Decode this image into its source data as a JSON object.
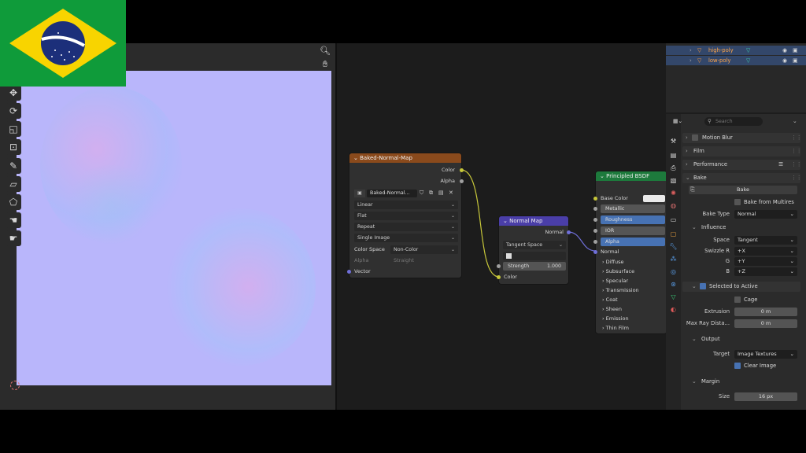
{
  "flag": {
    "name": "brazil-flag",
    "colors": {
      "green": "#0f9b3a",
      "yellow": "#f8d400",
      "blue": "#1c2f7a"
    }
  },
  "node_editor": {
    "image_node": {
      "title": "Baked-Normal-Map",
      "outputs": [
        "Color",
        "Alpha"
      ],
      "image_name": "Baked-Normal...",
      "interpolation": "Linear",
      "projection": "Flat",
      "extension": "Repeat",
      "source": "Single Image",
      "color_space_label": "Color Space",
      "color_space": "Non-Color",
      "alpha_label": "Alpha",
      "alpha_value": "Straight",
      "vector_input": "Vector",
      "header_color": "#8a4a1c"
    },
    "normal_map_node": {
      "title": "Normal Map",
      "output": "Normal",
      "space": "Tangent Space",
      "strength_label": "Strength",
      "strength_value": "1.000",
      "color_input": "Color",
      "header_color": "#4a3ea8"
    },
    "bsdf_node": {
      "title": "Principled BSDF",
      "header_color": "#1d7a3c",
      "base_color": "Base Color",
      "metallic": "Metallic",
      "roughness": "Roughness",
      "ior": "IOR",
      "alpha": "Alpha",
      "normal": "Normal",
      "panels": [
        "Diffuse",
        "Subsurface",
        "Specular",
        "Transmission",
        "Coat",
        "Sheen",
        "Emission",
        "Thin Film"
      ]
    }
  },
  "outliner": {
    "items": [
      {
        "label": "high-poly"
      },
      {
        "label": "low-poly"
      }
    ]
  },
  "properties": {
    "search_placeholder": "Search",
    "motion_blur": "Motion Blur",
    "film": "Film",
    "performance": "Performance",
    "bake": "Bake",
    "bake_button": "Bake",
    "bake_from_multires": "Bake from Multires",
    "bake_type_label": "Bake Type",
    "bake_type": "Normal",
    "influence": "Influence",
    "space_label": "Space",
    "space": "Tangent",
    "swizzle_r_label": "Swizzle R",
    "swizzle_r": "+X",
    "swizzle_g_label": "G",
    "swizzle_g": "+Y",
    "swizzle_b_label": "B",
    "swizzle_b": "+Z",
    "selected_to_active": "Selected to Active",
    "cage": "Cage",
    "extrusion_label": "Extrusion",
    "extrusion": "0 m",
    "max_ray_label": "Max Ray Dista...",
    "max_ray": "0 m",
    "output": "Output",
    "target_label": "Target",
    "target": "Image Textures",
    "clear_image": "Clear Image",
    "margin": "Margin",
    "size_label": "Size",
    "size": "16 px"
  }
}
